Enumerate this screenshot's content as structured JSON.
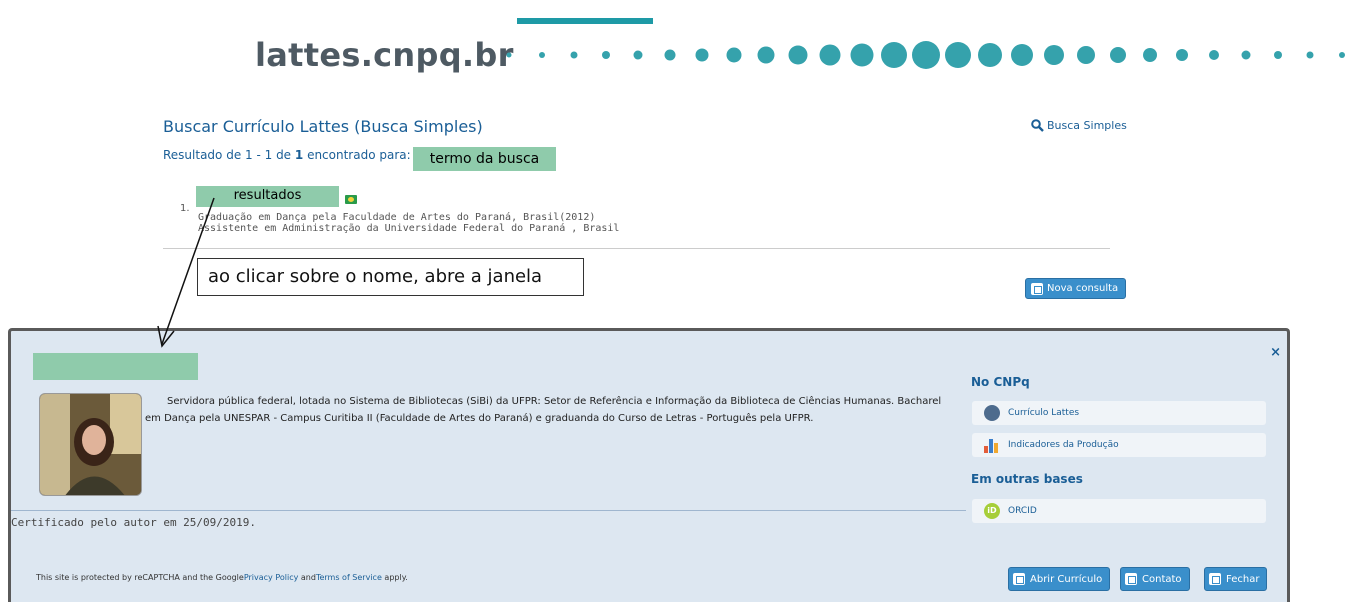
{
  "header": {
    "brand": "lattes.cnpq.br"
  },
  "search": {
    "title": "Buscar Currículo Lattes (Busca Simples)",
    "simple_search_link": "Busca Simples",
    "result_prefix": "Resultado de 1 - 1 de ",
    "result_count": "1",
    "result_suffix": " encontrado para:",
    "search_term_tag": "termo da busca",
    "results_tag": "resultados",
    "item_number": "1.",
    "item_line1": "Graduação em Dança pela Faculdade de Artes do Paraná, Brasil(2012)",
    "item_line2": "Assistente em Administração da Universidade Federal do Paraná , Brasil",
    "callout_text": "ao clicar sobre o nome, abre a janela",
    "new_search_button": "Nova consulta"
  },
  "modal": {
    "bio": "Servidora pública federal, lotada no Sistema de Bibliotecas (SiBi) da UFPR: Setor de Referência e Informação da Biblioteca de Ciências Humanas. Bacharel em Dança pela UNESPAR - Campus Curitiba II (Faculdade de Artes do Paraná) e graduanda do Curso de Letras - Português pela UFPR.",
    "certified": "Certificado pelo autor em 25/09/2019.",
    "close": "×",
    "section_cnpq": "No CNPq",
    "link_curriculo": "Currículo Lattes",
    "link_indicadores": "Indicadores da Produção",
    "section_outras": "Em outras bases",
    "link_orcid": "ORCID",
    "footer_prefix": "This site is protected by reCAPTCHA and the Google",
    "footer_privacy": "Privacy Policy",
    "footer_and": " and",
    "footer_terms": "Terms of Service",
    "footer_suffix": " apply.",
    "btn_abrir": "Abrir Currículo",
    "btn_contato": "Contato",
    "btn_fechar": "Fechar"
  },
  "colors": {
    "accent": "#1a5e96",
    "highlight": "#8fcbab",
    "button": "#3a8fcb",
    "teal": "#1e9aa6"
  }
}
